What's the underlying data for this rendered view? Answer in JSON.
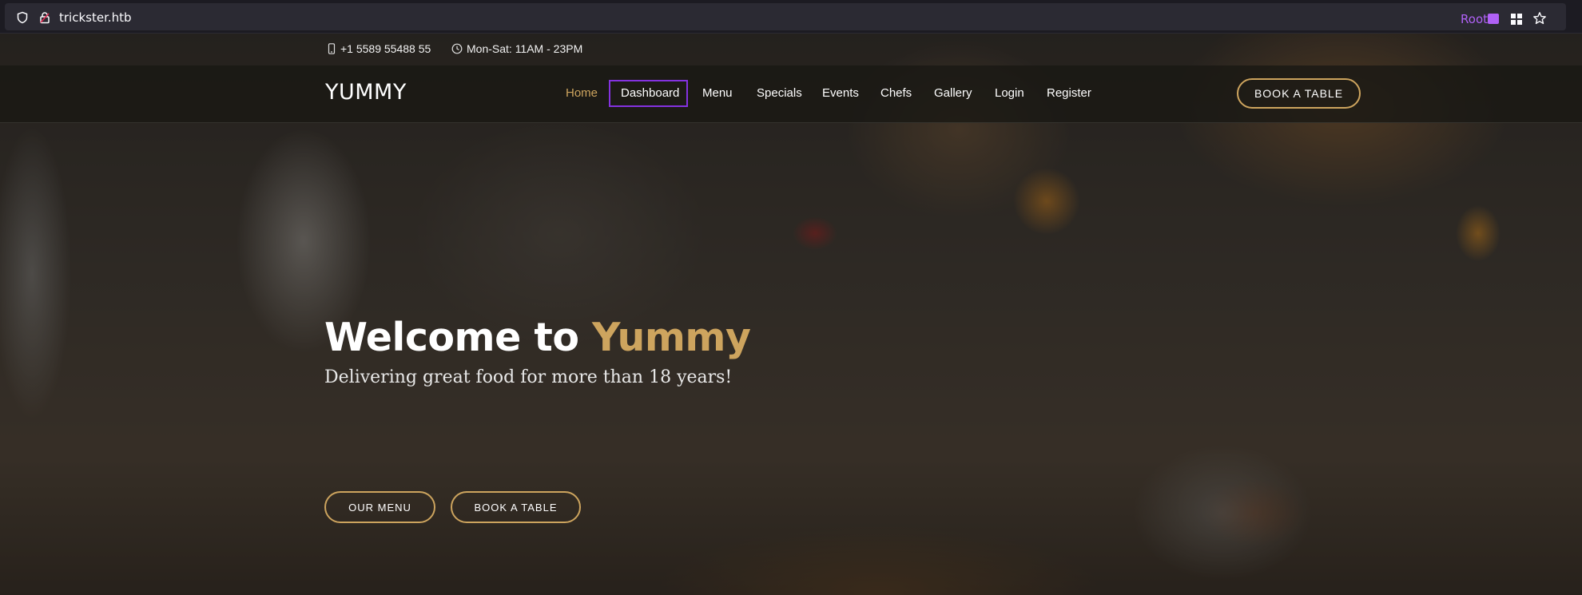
{
  "browser": {
    "url": "trickster.htb",
    "container_label": "Root"
  },
  "site": {
    "topbar": {
      "phone": "+1 5589 55488 55",
      "hours": "Mon-Sat: 11AM - 23PM"
    },
    "logo": "YUMMY",
    "nav": {
      "items": [
        {
          "label": "Home"
        },
        {
          "label": "Dashboard"
        },
        {
          "label": "Menu"
        },
        {
          "label": "Specials"
        },
        {
          "label": "Events"
        },
        {
          "label": "Chefs"
        },
        {
          "label": "Gallery"
        },
        {
          "label": "Login"
        },
        {
          "label": "Register"
        }
      ],
      "book_button": "BOOK A TABLE"
    },
    "hero": {
      "title_prefix": "Welcome to ",
      "title_accent": "Yummy",
      "subtitle": "Delivering great food for more than 18 years!",
      "menu_button": "OUR MENU",
      "book_button": "BOOK A TABLE"
    }
  },
  "colors": {
    "accent": "#cda45e",
    "container": "#b061f6",
    "focus_outline": "#8432e0"
  },
  "icons": [
    "shield-icon",
    "lock-icon",
    "briefcase-icon",
    "extensions-icon",
    "bookmark-star-icon",
    "phone-icon",
    "clock-icon"
  ]
}
